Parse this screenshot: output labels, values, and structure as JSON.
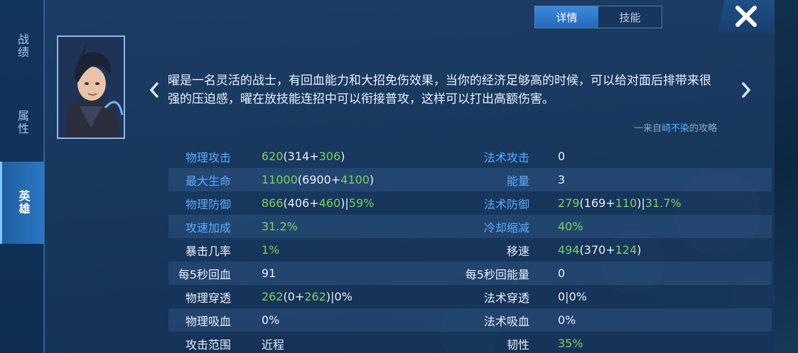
{
  "side_tabs": [
    {
      "label": "战绩",
      "active": false
    },
    {
      "label": "属性",
      "active": false
    },
    {
      "label": "英雄",
      "active": true
    }
  ],
  "top_tabs": [
    {
      "label": "详情",
      "active": true
    },
    {
      "label": "技能",
      "active": false
    }
  ],
  "close_icon": "close-icon",
  "hero": {
    "description": "曜是一名灵活的战士，有回血能力和大招免伤效果，当你的经济足够高的时候，可以给对面后排带来很强的压迫感，曜在放技能连招中可以衔接普攻，这样可以打出高额伤害。",
    "credit_prefix": "一来自",
    "credit_author": "崎不染",
    "credit_suffix": "的攻略"
  },
  "colors": {
    "label_blue": "#5aa9ff",
    "bonus_green": "#78d25a",
    "text_white": "#e7eef7",
    "active_tab": "#2a77c3"
  },
  "stats": [
    {
      "l1": "物理攻击",
      "l1c": "blue",
      "v1": [
        [
          "620",
          "g"
        ],
        [
          "(314+",
          "w"
        ],
        [
          "306",
          "g"
        ],
        [
          ")",
          "w"
        ]
      ],
      "l2": "法术攻击",
      "l2c": "blue",
      "v2": [
        [
          "0",
          "w"
        ]
      ]
    },
    {
      "l1": "最大生命",
      "l1c": "blue",
      "v1": [
        [
          "11000",
          "g"
        ],
        [
          "(6900+",
          "w"
        ],
        [
          "4100",
          "g"
        ],
        [
          ")",
          "w"
        ]
      ],
      "l2": "能量",
      "l2c": "blue",
      "v2": [
        [
          "3",
          "w"
        ]
      ]
    },
    {
      "l1": "物理防御",
      "l1c": "blue",
      "v1": [
        [
          "866",
          "g"
        ],
        [
          "(406+",
          "w"
        ],
        [
          "460",
          "g"
        ],
        [
          ")|",
          "w"
        ],
        [
          "59%",
          "g"
        ]
      ],
      "l2": "法术防御",
      "l2c": "blue",
      "v2": [
        [
          "279",
          "g"
        ],
        [
          "(169+",
          "w"
        ],
        [
          "110",
          "g"
        ],
        [
          ")|",
          "w"
        ],
        [
          "31.7%",
          "g"
        ]
      ]
    },
    {
      "l1": "攻速加成",
      "l1c": "blue",
      "v1": [
        [
          "31.2%",
          "g"
        ]
      ],
      "l2": "冷却缩减",
      "l2c": "blue",
      "v2": [
        [
          "40%",
          "g"
        ]
      ]
    },
    {
      "l1": "暴击几率",
      "l1c": "white",
      "v1": [
        [
          "1%",
          "g"
        ]
      ],
      "l2": "移速",
      "l2c": "white",
      "v2": [
        [
          "494",
          "g"
        ],
        [
          "(370+",
          "w"
        ],
        [
          "124",
          "g"
        ],
        [
          ")",
          "w"
        ]
      ]
    },
    {
      "l1": "每5秒回血",
      "l1c": "white",
      "v1": [
        [
          "91",
          "w"
        ]
      ],
      "l2": "每5秒回能量",
      "l2c": "white",
      "v2": [
        [
          "0",
          "w"
        ]
      ]
    },
    {
      "l1": "物理穿透",
      "l1c": "white",
      "v1": [
        [
          "262",
          "g"
        ],
        [
          "(0+",
          "w"
        ],
        [
          "262",
          "g"
        ],
        [
          ")|0%",
          "w"
        ]
      ],
      "l2": "法术穿透",
      "l2c": "white",
      "v2": [
        [
          "0|0%",
          "w"
        ]
      ]
    },
    {
      "l1": "物理吸血",
      "l1c": "white",
      "v1": [
        [
          "0%",
          "w"
        ]
      ],
      "l2": "法术吸血",
      "l2c": "white",
      "v2": [
        [
          "0%",
          "w"
        ]
      ]
    },
    {
      "l1": "攻击范围",
      "l1c": "white",
      "v1": [
        [
          "近程",
          "w"
        ]
      ],
      "l2": "韧性",
      "l2c": "white",
      "v2": [
        [
          "35%",
          "g"
        ]
      ]
    }
  ]
}
